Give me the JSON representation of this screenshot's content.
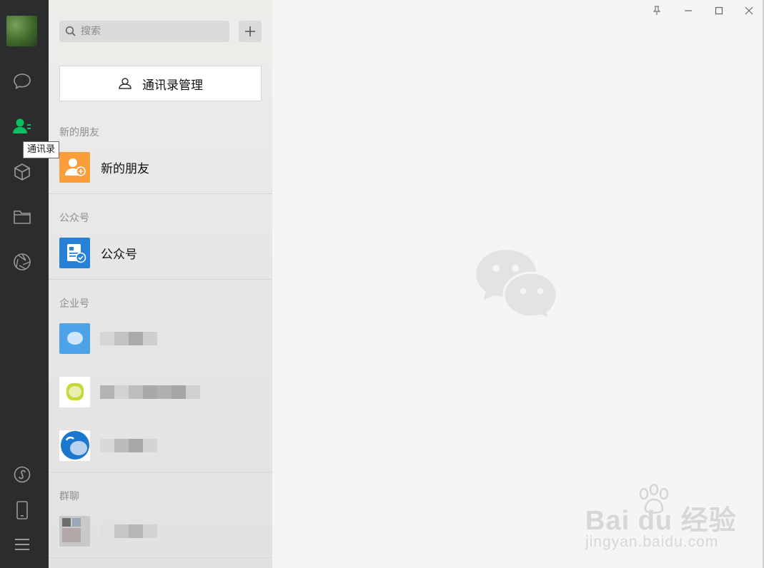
{
  "nav": {
    "tooltip": "通讯录",
    "items": [
      {
        "name": "chat"
      },
      {
        "name": "contacts"
      },
      {
        "name": "favorites"
      },
      {
        "name": "files"
      },
      {
        "name": "moments"
      },
      {
        "name": "mini-programs"
      },
      {
        "name": "phone"
      },
      {
        "name": "menu"
      }
    ],
    "active_color": "#07c160"
  },
  "search": {
    "placeholder": "搜索",
    "value": ""
  },
  "contacts": {
    "manage_label": "通讯录管理",
    "sections": [
      {
        "title": "新的朋友",
        "items": [
          {
            "label": "新的朋友",
            "icon": "new-friend-icon",
            "color": "#fa9d3b"
          }
        ]
      },
      {
        "title": "公众号",
        "items": [
          {
            "label": "公众号",
            "icon": "official-account-icon",
            "color": "#2782d7"
          }
        ]
      },
      {
        "title": "企业号",
        "items": [
          {
            "label": ""
          },
          {
            "label": ""
          },
          {
            "label": ""
          }
        ]
      },
      {
        "title": "群聊",
        "items": [
          {
            "label": ""
          }
        ]
      }
    ]
  },
  "watermark": {
    "brand": "Bai du 经验",
    "url": "jingyan.baidu.com"
  }
}
